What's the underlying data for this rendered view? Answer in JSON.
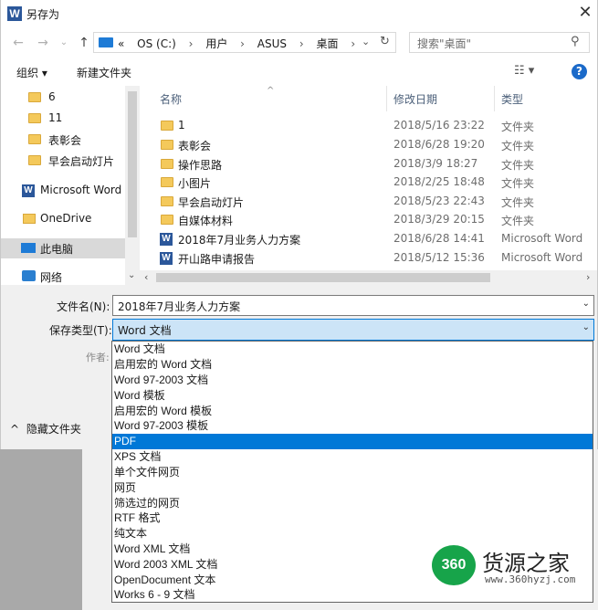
{
  "window": {
    "title": "另存为",
    "title_icon": "W",
    "close_glyph": "✕"
  },
  "address": {
    "back": "←",
    "forward": "→",
    "recent": "⌄",
    "up": "↑",
    "overflow": "«",
    "crumbs": [
      "OS (C:)",
      "用户",
      "ASUS",
      "桌面"
    ],
    "sep": "›",
    "dropdown": "⌄",
    "refresh": "↻"
  },
  "search": {
    "placeholder": "搜索\"桌面\"",
    "icon": "⚲"
  },
  "toolbar": {
    "organize": "组织 ▾",
    "new_folder": "新建文件夹",
    "view_glyph": "☷ ▾",
    "help_glyph": "?"
  },
  "nav": {
    "items": [
      {
        "label": "6",
        "icon": "folder"
      },
      {
        "label": "11",
        "icon": "folder"
      },
      {
        "label": "表彰会",
        "icon": "folder"
      },
      {
        "label": "早会启动灯片",
        "icon": "folder"
      },
      {
        "label": "Microsoft Word",
        "icon": "word"
      },
      {
        "label": "OneDrive",
        "icon": "onedrive"
      },
      {
        "label": "此电脑",
        "icon": "pc"
      },
      {
        "label": "网络",
        "icon": "network"
      }
    ],
    "scroll_down": "⌄"
  },
  "columns": {
    "name": "名称",
    "modified": "修改日期",
    "type": "类型",
    "sort_caret": "^"
  },
  "files": [
    {
      "name": "1",
      "date": "2018/5/16 23:22",
      "type": "文件夹",
      "icon": "folder"
    },
    {
      "name": "表彰会",
      "date": "2018/6/28 19:20",
      "type": "文件夹",
      "icon": "folder"
    },
    {
      "name": "操作思路",
      "date": "2018/3/9 18:27",
      "type": "文件夹",
      "icon": "folder"
    },
    {
      "name": "小图片",
      "date": "2018/2/25 18:48",
      "type": "文件夹",
      "icon": "folder"
    },
    {
      "name": "早会启动灯片",
      "date": "2018/5/23 22:43",
      "type": "文件夹",
      "icon": "folder"
    },
    {
      "name": "自媒体材料",
      "date": "2018/3/29 20:15",
      "type": "文件夹",
      "icon": "folder"
    },
    {
      "name": "2018年7月业务人力方案",
      "date": "2018/6/28 14:41",
      "type": "Microsoft Word",
      "icon": "word"
    },
    {
      "name": "开山路申请报告",
      "date": "2018/5/12 15:36",
      "type": "Microsoft Word",
      "icon": "word"
    }
  ],
  "hscroll": {
    "left": "‹",
    "right": "›"
  },
  "form": {
    "filename_label": "文件名(N):",
    "filename_value": "2018年7月业务人力方案",
    "savetype_label": "保存类型(T):",
    "savetype_value": "Word 文档",
    "author_label": "作者:",
    "hide_folders": "隐藏文件夹",
    "hide_glyph": "^",
    "dd_glyph": "⌄"
  },
  "savetype_options": [
    "Word 文档",
    "启用宏的 Word 文档",
    "Word 97-2003 文档",
    "Word 模板",
    "启用宏的 Word 模板",
    "Word 97-2003 模板",
    "PDF",
    "XPS 文档",
    "单个文件网页",
    "网页",
    "筛选过的网页",
    "RTF 格式",
    "纯文本",
    "Word XML 文档",
    "Word 2003 XML 文档",
    "OpenDocument 文本",
    "Works 6 - 9 文档"
  ],
  "selected_option_index": 6,
  "watermark": {
    "logo": "360",
    "name": "货源之家",
    "url": "www.360hyzj.com"
  },
  "colors": {
    "accent": "#0078d7",
    "selected_nav": "#d9d9d9",
    "folder": "#f4c95b",
    "word": "#2b579a"
  }
}
